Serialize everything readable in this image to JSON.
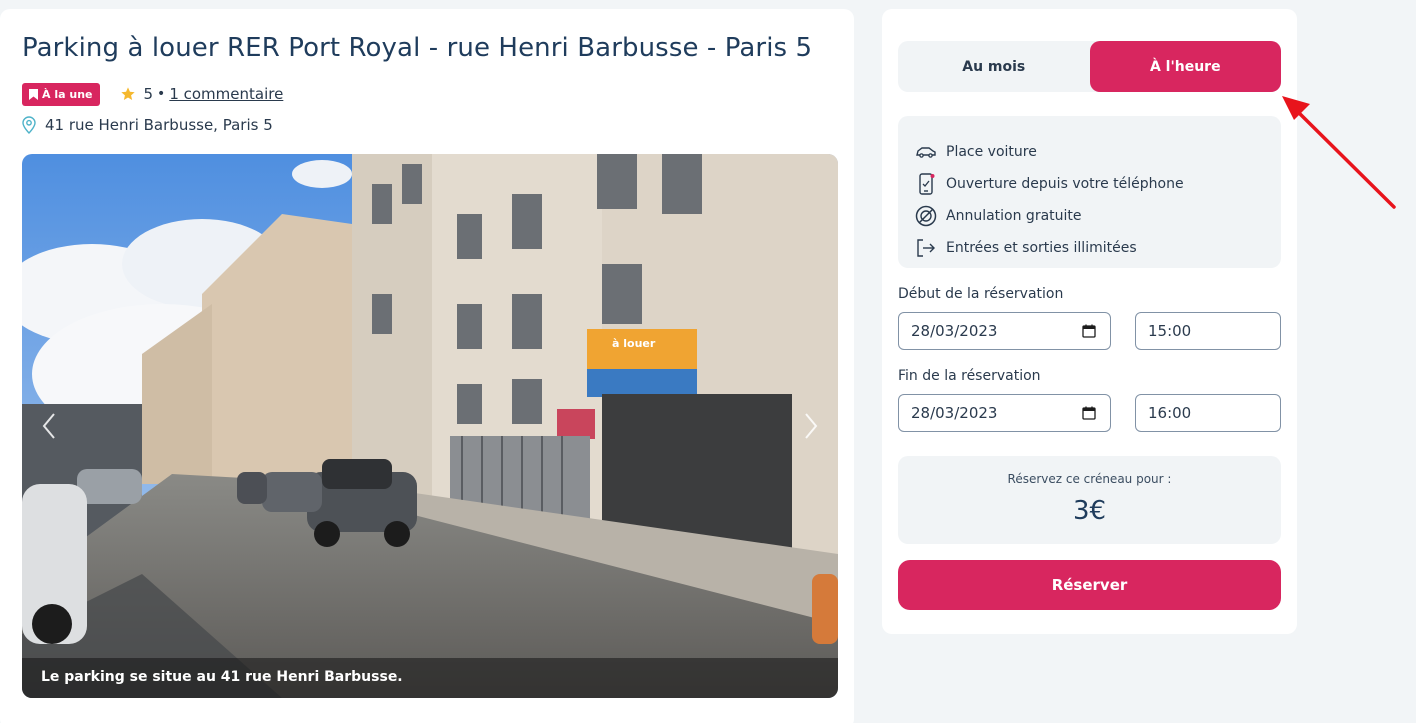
{
  "listing": {
    "title": "Parking à louer RER Port Royal - rue Henri Barbusse - Paris 5",
    "badge": "À la une",
    "rating": "5",
    "separator": "•",
    "review_link": "1 commentaire",
    "address": "41 rue Henri Barbusse, Paris 5",
    "photo_caption": "Le parking se situe au 41 rue Henri Barbusse.",
    "photo_sign_text": "à louer"
  },
  "booking": {
    "tabs": [
      {
        "label": "Au mois",
        "active": false
      },
      {
        "label": "À l'heure",
        "active": true
      }
    ],
    "features": [
      {
        "icon": "car-icon",
        "label": "Place voiture"
      },
      {
        "icon": "phone-icon",
        "label": "Ouverture depuis votre téléphone"
      },
      {
        "icon": "no-fee-icon",
        "label": "Annulation gratuite"
      },
      {
        "icon": "exit-icon",
        "label": "Entrées et sorties illimitées"
      }
    ],
    "start_label": "Début de la réservation",
    "start_date": "28/03/2023",
    "start_time": "15:00",
    "end_label": "Fin de la réservation",
    "end_date": "28/03/2023",
    "end_time": "16:00",
    "price_label": "Réservez ce créneau pour :",
    "price_value": "3€",
    "reserve_label": "Réserver"
  },
  "colors": {
    "accent": "#d8265f",
    "title": "#1f3c5c",
    "panel": "#f1f4f6",
    "annotation_arrow": "#e8141c"
  }
}
